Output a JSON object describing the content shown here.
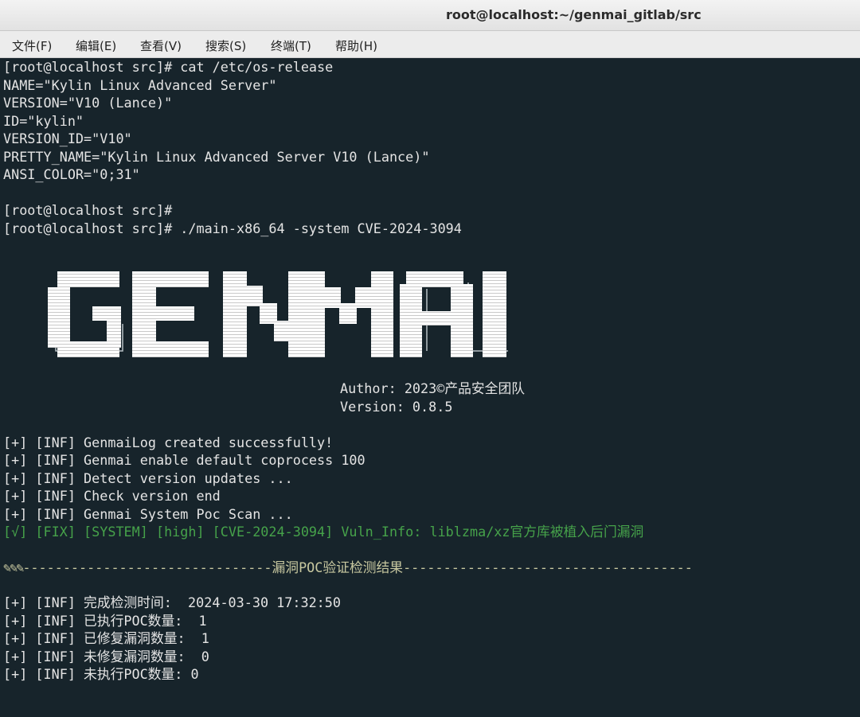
{
  "window": {
    "title": "root@localhost:~/genmai_gitlab/src"
  },
  "menu": [
    "文件(F)",
    "编辑(E)",
    "查看(V)",
    "搜索(S)",
    "终端(T)",
    "帮助(H)"
  ],
  "terminal": {
    "block1": [
      "[root@localhost src]# cat /etc/os-release",
      "NAME=\"Kylin Linux Advanced Server\"",
      "VERSION=\"V10 (Lance)\"",
      "ID=\"kylin\"",
      "VERSION_ID=\"V10\"",
      "PRETTY_NAME=\"Kylin Linux Advanced Server V10 (Lance)\"",
      "ANSI_COLOR=\"0;31\"",
      "",
      "[root@localhost src]#",
      "[root@localhost src]# ./main-x86_64 -system CVE-2024-3094"
    ],
    "banner_text": "GENMAI",
    "author": "Author: 2023©产品安全团队",
    "version": "Version: 0.8.5",
    "logs": [
      "[+] [INF] GenmaiLog created successfully!",
      "[+] [INF] Genmai enable default coprocess 100",
      "[+] [INF] Detect version updates ...",
      "[+] [INF] Check version end",
      "[+] [INF] Genmai System Poc Scan ..."
    ],
    "finding": "[√] [FIX] [SYSTEM] [high] [CVE-2024-3094] Vuln_Info: liblzma/xz官方库被植入后门漏洞",
    "separator_left": "-------------------------------",
    "separator_title": "漏洞POC验证检测结果",
    "separator_right": "------------------------------------",
    "results": [
      "[+] [INF] 完成检测时间:  2024-03-30 17:32:50",
      "[+] [INF] 已执行POC数量:  1",
      "[+] [INF] 已修复漏洞数量:  1",
      "[+] [INF] 未修复漏洞数量:  0",
      "[+] [INF] 未执行POC数量: 0"
    ]
  },
  "colors": {
    "background": "#17242b",
    "text": "#e4e4e4",
    "fix_green": "#46a24a"
  }
}
